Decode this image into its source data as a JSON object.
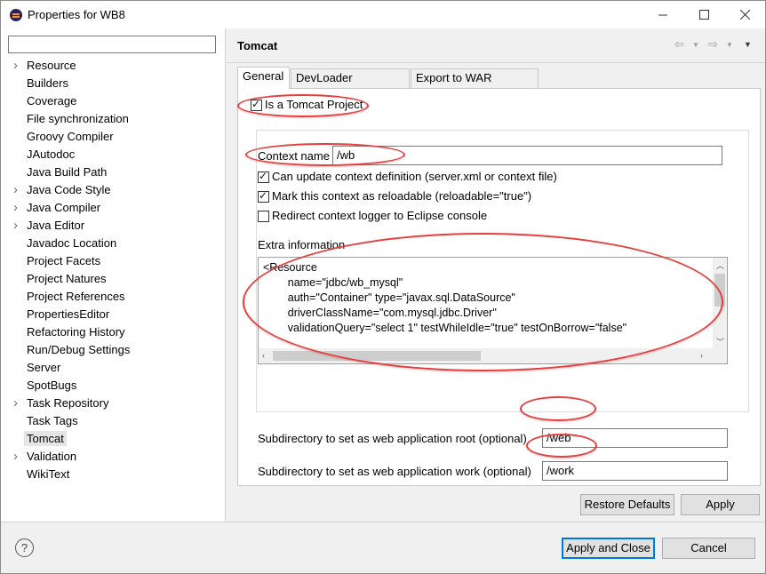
{
  "window": {
    "title": "Properties for WB8",
    "minimize_icon": "minimize-icon",
    "maximize_icon": "maximize-icon",
    "close_icon": "close-icon"
  },
  "sidebar": {
    "filter_placeholder": "",
    "items": [
      {
        "label": "Resource",
        "expandable": true,
        "selected": false
      },
      {
        "label": "Builders",
        "expandable": false,
        "selected": false
      },
      {
        "label": "Coverage",
        "expandable": false,
        "selected": false
      },
      {
        "label": "File synchronization",
        "expandable": false,
        "selected": false
      },
      {
        "label": "Groovy Compiler",
        "expandable": false,
        "selected": false
      },
      {
        "label": "JAutodoc",
        "expandable": false,
        "selected": false
      },
      {
        "label": "Java Build Path",
        "expandable": false,
        "selected": false
      },
      {
        "label": "Java Code Style",
        "expandable": true,
        "selected": false
      },
      {
        "label": "Java Compiler",
        "expandable": true,
        "selected": false
      },
      {
        "label": "Java Editor",
        "expandable": true,
        "selected": false
      },
      {
        "label": "Javadoc Location",
        "expandable": false,
        "selected": false
      },
      {
        "label": "Project Facets",
        "expandable": false,
        "selected": false
      },
      {
        "label": "Project Natures",
        "expandable": false,
        "selected": false
      },
      {
        "label": "Project References",
        "expandable": false,
        "selected": false
      },
      {
        "label": "PropertiesEditor",
        "expandable": false,
        "selected": false
      },
      {
        "label": "Refactoring History",
        "expandable": false,
        "selected": false
      },
      {
        "label": "Run/Debug Settings",
        "expandable": false,
        "selected": false
      },
      {
        "label": "Server",
        "expandable": false,
        "selected": false
      },
      {
        "label": "SpotBugs",
        "expandable": false,
        "selected": false
      },
      {
        "label": "Task Repository",
        "expandable": true,
        "selected": false
      },
      {
        "label": "Task Tags",
        "expandable": false,
        "selected": false
      },
      {
        "label": "Tomcat",
        "expandable": false,
        "selected": true
      },
      {
        "label": "Validation",
        "expandable": true,
        "selected": false
      },
      {
        "label": "WikiText",
        "expandable": false,
        "selected": false
      }
    ]
  },
  "page": {
    "title": "Tomcat",
    "back_icon": "back-arrow-icon",
    "forward_icon": "forward-arrow-icon",
    "menu_icon": "view-menu-icon"
  },
  "tabs": [
    {
      "label": "General",
      "active": true
    },
    {
      "label": "DevLoader Classpath",
      "active": false
    },
    {
      "label": "Export to WAR settings",
      "active": false
    }
  ],
  "general": {
    "is_tomcat_project": {
      "label": "Is a Tomcat Project",
      "checked": true
    },
    "context_name": {
      "label": "Context name",
      "value": "/wb"
    },
    "options": [
      {
        "label": "Can update context definition (server.xml or context file)",
        "checked": true
      },
      {
        "label": "Mark this context as reloadable (reloadable=\"true\")",
        "checked": true
      },
      {
        "label": "Redirect context logger to Eclipse console",
        "checked": false
      }
    ],
    "extra_info": {
      "label": "Extra information",
      "lines": [
        "<Resource",
        "        name=\"jdbc/wb_mysql\"",
        "        auth=\"Container\" type=\"javax.sql.DataSource\"",
        "        driverClassName=\"com.mysql.jdbc.Driver\"",
        "        validationQuery=\"select 1\" testWhileIdle=\"true\" testOnBorrow=\"false\""
      ]
    },
    "web_root": {
      "label": "Subdirectory to set as web application root (optional)",
      "value": "/web"
    },
    "work_dir": {
      "label": "Subdirectory to set as web application work (optional)",
      "value": "/work"
    }
  },
  "page_buttons": {
    "restore_defaults": "Restore Defaults",
    "apply": "Apply"
  },
  "dialog_buttons": {
    "help_icon": "help-icon",
    "help_glyph": "?",
    "apply_and_close": "Apply and Close",
    "cancel": "Cancel"
  },
  "annotation_color": "#e34040"
}
